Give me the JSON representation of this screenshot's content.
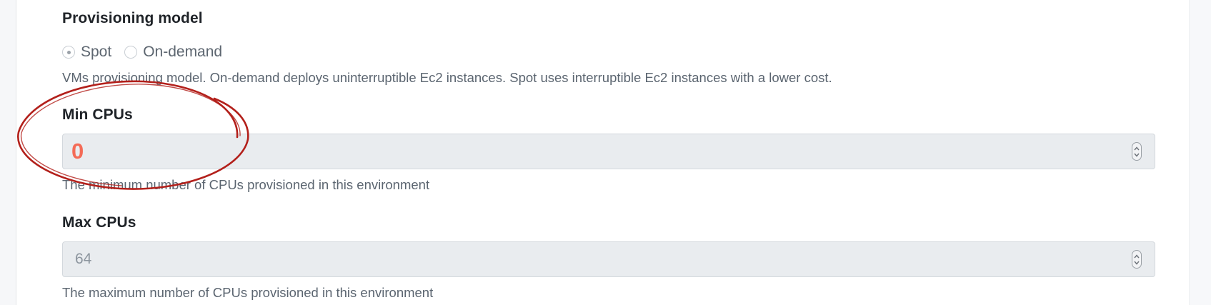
{
  "provisioning": {
    "title": "Provisioning model",
    "options": [
      {
        "label": "Spot",
        "checked": true
      },
      {
        "label": "On-demand",
        "checked": false
      }
    ],
    "help": "VMs provisioning model. On-demand deploys uninterruptible Ec2 instances. Spot uses interruptible Ec2 instances with a lower cost."
  },
  "min_cpus": {
    "title": "Min CPUs",
    "value": "0",
    "help": "The minimum number of CPUs provisioned in this environment"
  },
  "max_cpus": {
    "title": "Max CPUs",
    "value": "64",
    "help": "The maximum number of CPUs provisioned in this environment"
  },
  "colors": {
    "annotation": "#b3201b",
    "highlight_value": "#f46b57",
    "field_background": "#e9ecef"
  },
  "icons": {
    "stepper": "up-down-chevron-icon",
    "radio_checked": "radio-checked-icon",
    "radio_unchecked": "radio-unchecked-icon"
  }
}
